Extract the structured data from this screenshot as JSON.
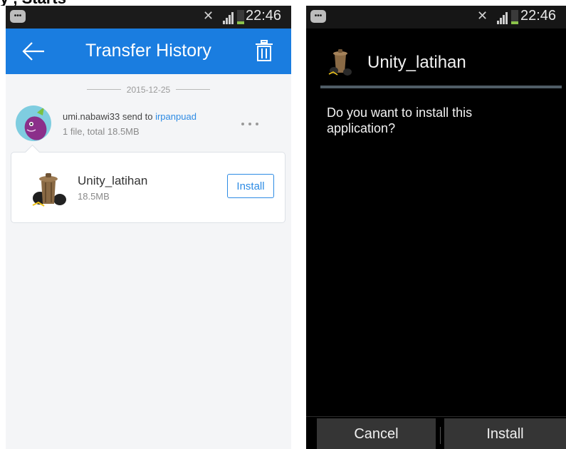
{
  "page_heading_partial": "y , Starts",
  "left_screen": {
    "status_bar": {
      "time": "22:46",
      "battery_level": 0.18
    },
    "app_bar": {
      "title": "Transfer History",
      "back_icon": "arrow-left-icon",
      "delete_icon": "trash-icon"
    },
    "history": {
      "date": "2015-12-25",
      "entry": {
        "sender": "umi.nabawi33",
        "action": " send to ",
        "recipient": "irpanpuad",
        "summary": "1 file, total 18.5MB",
        "more_icon": "more-horizontal-icon",
        "file": {
          "name": "Unity_latihan",
          "size": "18.5MB",
          "install_label": "Install"
        }
      }
    },
    "colors": {
      "app_bar": "#1a7de0",
      "link": "#2d8be4"
    }
  },
  "right_screen": {
    "status_bar": {
      "time": "22:46",
      "battery_level": 0.18
    },
    "dialog": {
      "app_name": "Unity_latihan",
      "message": "Do you want to install this application?",
      "cancel_label": "Cancel",
      "install_label": "Install"
    }
  }
}
